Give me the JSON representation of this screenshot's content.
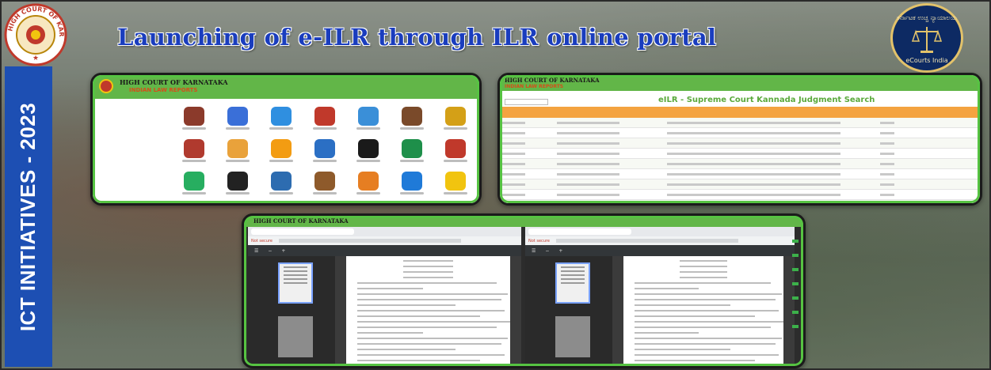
{
  "headline": "Launching of e-ILR through ILR online portal",
  "side_title": "ICT INITIATIVES - 2023",
  "logos": {
    "left_seal": "HIGH COURT OF KARNATAKA",
    "right_seal_top": "ಕರ್ನಾಟಕ ಉಚ್ಚ ನ್ಯಾಯಾಲಯ",
    "right_seal_bottom": "eCourts India"
  },
  "panel_home": {
    "court_name": "HIGH COURT OF KARNATAKA",
    "portal_name": "INDIAN LAW REPORTS",
    "tile_colors": [
      "#8b3a2b",
      "#3a6fd8",
      "#2f8fe0",
      "#c0392b",
      "#3a8fd8",
      "#7a4a2a",
      "#d4a017",
      "#b03a2e",
      "#e9a23b",
      "#f39c12",
      "#2b6fc4",
      "#1a1a1a",
      "#1e8f4a",
      "#c0392b",
      "#27ae60",
      "#222222",
      "#2d6cb0",
      "#8e5a2b",
      "#e67e22",
      "#1f7ad8",
      "#f1c40f",
      "#f39c12"
    ]
  },
  "panel_search": {
    "court_name": "HIGH COURT OF KARNATAKA",
    "portal_name": "INDIAN LAW REPORTS",
    "title": "eILR - Supreme Court Kannada Judgment Search"
  },
  "panel_pdf": {
    "court_name": "HIGH COURT OF KARNATAKA",
    "left_warning": "Not secure",
    "right_warning": "Not secure"
  },
  "colors": {
    "accent_blue": "#1a3dbe",
    "side_band": "#1d4fb3",
    "portal_green": "#62b648",
    "table_header": "#f4a340"
  }
}
